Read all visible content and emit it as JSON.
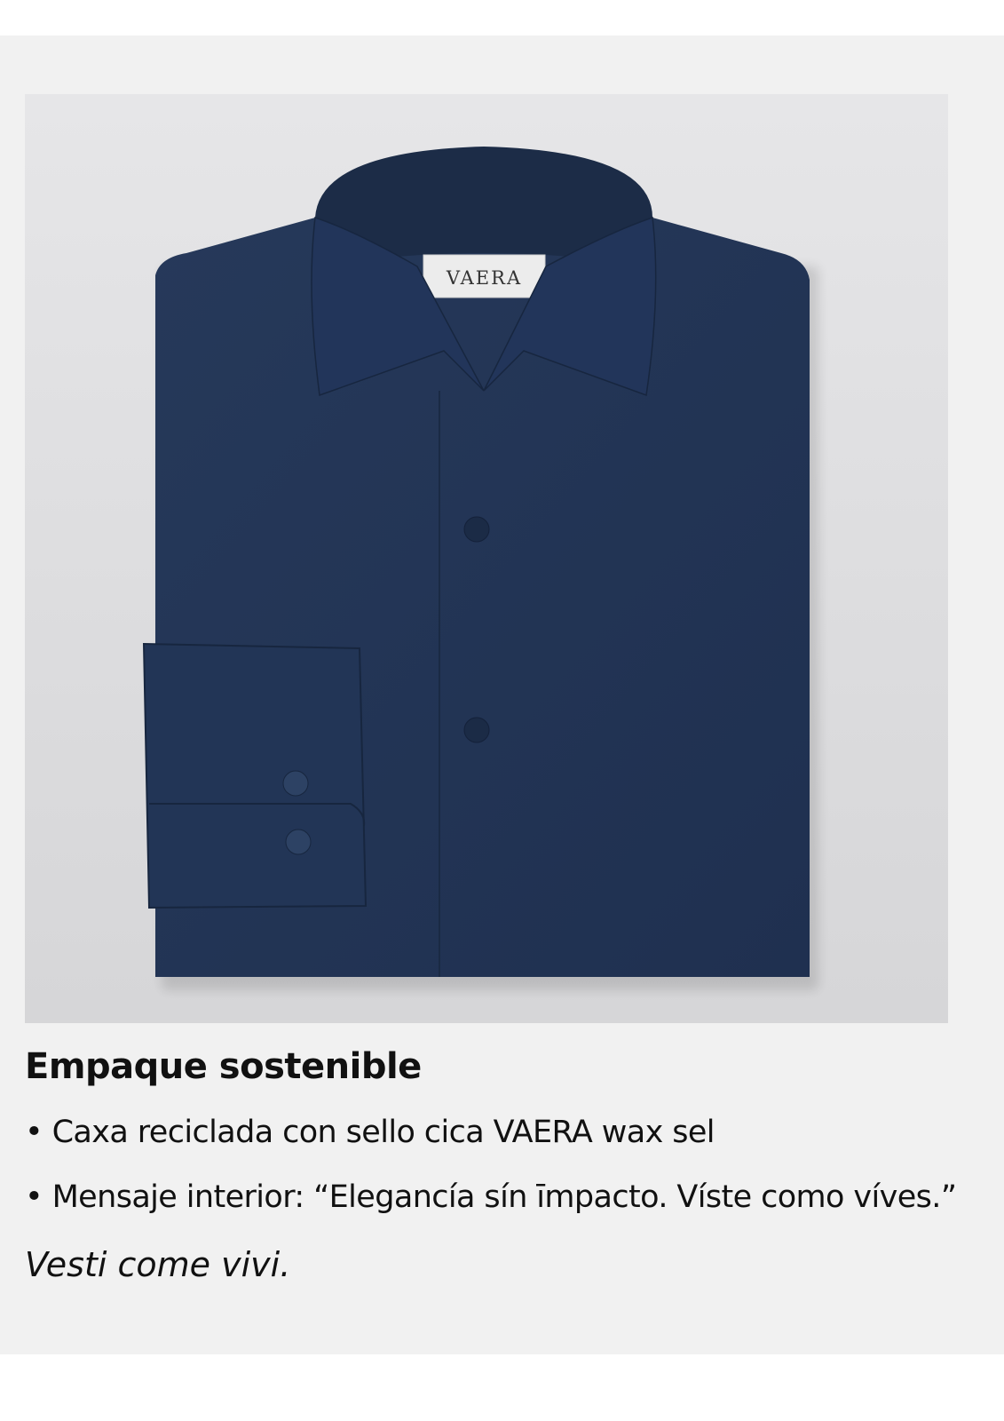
{
  "product_image": {
    "label_text": "VAERA",
    "shirt_color": "#233650"
  },
  "section": {
    "title": "Empaque sostenible",
    "bullets": [
      "Caxa reciclada con sello cica VAERA wax sel",
      "Mensaje interior: “Elegancía sín īmpacto. Víste como víves.”"
    ],
    "bullet_marker": "•",
    "tagline": "Vesti come vivi."
  }
}
